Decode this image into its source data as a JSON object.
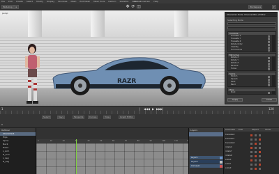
{
  "menubar": {
    "items": [
      "File",
      "Edit",
      "Create",
      "Select",
      "Modify",
      "Display",
      "Windows",
      "Mesh",
      "Edit Mesh",
      "Mesh Tools",
      "Deform",
      "Skeleton",
      "Skin",
      "Constrain",
      "Help"
    ],
    "center_title": "Global"
  },
  "toolbar": {
    "left_buttons": [
      "Modeling",
      "≡"
    ],
    "right_buttons": [
      "Workspace",
      "▾"
    ],
    "icons": [
      "move-icon",
      "rotate-icon",
      "scale-icon"
    ]
  },
  "viewport": {
    "label_left": "persp",
    "label_right": "",
    "colors": {
      "car": "#6f8fb3",
      "car_dark": "#1d2630",
      "wall": "#d9d9d9",
      "floor": "#9a9a9a"
    }
  },
  "attribute_panel": {
    "title": "Character Tools: Channel Box / Editor",
    "sub_label": "Selecting Node",
    "groups": [
      {
        "name": "Controls",
        "rows": [
          "Translate X",
          "Translate Y",
          "Translate Z",
          "Rotate Order",
          "Visibility",
          "Full Controls"
        ]
      },
      {
        "name": "Mirroring",
        "rows": [
          "Rotate X",
          "Rotate Y",
          "Rotate Z",
          "Reverse",
          "Follow"
        ]
      },
      {
        "name": "Spine",
        "rows": [
          "Stretch",
          "Squash",
          "Twist",
          "Bend"
        ]
      },
      {
        "name": "Hips",
        "rows": [
          "Pivot"
        ]
      }
    ],
    "buttons": {
      "apply": "Apply",
      "close": "Close"
    }
  },
  "timebar": {
    "transport": [
      "|◀",
      "◀◀",
      "◀",
      "▶",
      "▶▶",
      "▶|"
    ],
    "frame_start": "1",
    "frame_end": "120"
  },
  "strip": {
    "labels": [
      "Select",
      "Keys",
      "Tangents",
      "Curves",
      "View",
      "Graph Editor"
    ],
    "time_label": "0"
  },
  "outliner": {
    "header": "Outliner",
    "items": [
      "Character1",
      "Hips",
      "Spine",
      "Neck",
      "Head",
      "L_Arm",
      "R_Arm",
      "L_Leg",
      "R_Leg"
    ],
    "selected_index": 0
  },
  "graph": {
    "ruler_ticks": [
      "0",
      "10",
      "20",
      "30",
      "40",
      "50",
      "60",
      "70",
      "80",
      "90",
      "100",
      "110",
      "120"
    ],
    "current_frame_fraction": 0.26
  },
  "layers": {
    "header": "Layers",
    "rows": [
      "Layer1",
      "Layer2",
      "CarLayer"
    ],
    "swatch_colors": [
      "#6b8fc0",
      "#c0c0c0",
      "#d05050"
    ]
  },
  "channels": {
    "tabs": [
      "Channels",
      "Edit",
      "Object",
      "Show"
    ],
    "rows": [
      "translateX",
      "translateY",
      "translateZ",
      "rotateX",
      "rotateY",
      "rotateZ",
      "scaleX",
      "scaleY",
      "scaleZ"
    ]
  }
}
